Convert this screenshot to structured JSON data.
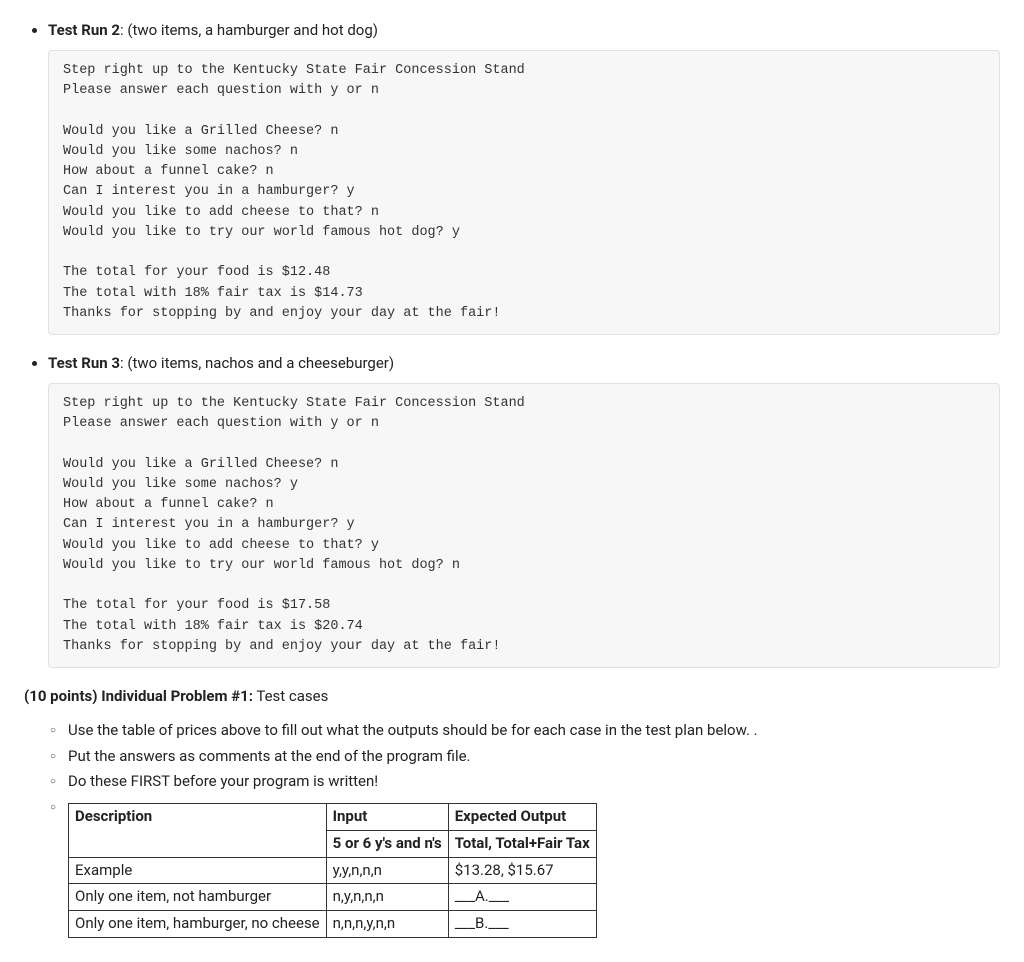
{
  "run2": {
    "heading_label": "Test Run 2",
    "heading_desc": ": (two items, a hamburger and hot dog)",
    "output": "Step right up to the Kentucky State Fair Concession Stand\nPlease answer each question with y or n\n\nWould you like a Grilled Cheese? n\nWould you like some nachos? n\nHow about a funnel cake? n\nCan I interest you in a hamburger? y\nWould you like to add cheese to that? n\nWould you like to try our world famous hot dog? y\n\nThe total for your food is $12.48\nThe total with 18% fair tax is $14.73\nThanks for stopping by and enjoy your day at the fair!"
  },
  "run3": {
    "heading_label": "Test Run 3",
    "heading_desc": ": (two items, nachos and a cheeseburger)",
    "output": "Step right up to the Kentucky State Fair Concession Stand\nPlease answer each question with y or n\n\nWould you like a Grilled Cheese? n\nWould you like some nachos? y\nHow about a funnel cake? n\nCan I interest you in a hamburger? y\nWould you like to add cheese to that? y\nWould you like to try our world famous hot dog? n\n\nThe total for your food is $17.58\nThe total with 18% fair tax is $20.74\nThanks for stopping by and enjoy your day at the fair!"
  },
  "problem": {
    "points_label": "(10 points) Individual Problem #1:",
    "title": " Test cases",
    "bullets": [
      "Use the table of prices above to fill out what the outputs should be for each case in the test plan below. .",
      "Put the answers as comments at the end of the program file.",
      "Do these FIRST before your program is written!"
    ]
  },
  "table": {
    "headers": {
      "desc": "Description",
      "input_top": "Input",
      "input_sub": "5 or 6 y's and n's",
      "output_top": "Expected Output",
      "output_sub": "Total, Total+Fair Tax"
    },
    "rows": [
      {
        "desc": "Example",
        "input": "y,y,n,n,n",
        "output": "$13.28, $15.67"
      },
      {
        "desc": "Only one item, not hamburger",
        "input": "n,y,n,n,n",
        "output": "___A.___"
      },
      {
        "desc": "Only one item, hamburger, no cheese",
        "input": "n,n,n,y,n,n",
        "output": "___B.___"
      }
    ]
  }
}
